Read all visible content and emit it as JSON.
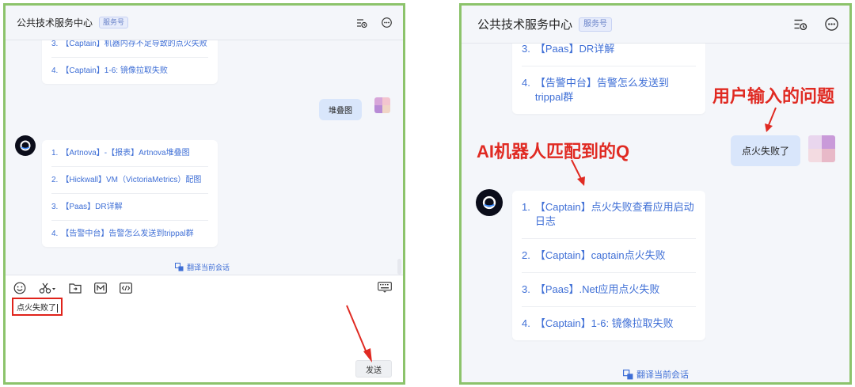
{
  "left": {
    "header": {
      "title": "公共技术服务中心",
      "badge": "服务号"
    },
    "top_card": {
      "items": [
        {
          "num": "3.",
          "text": "【Captain】机器内存不足导致的点火失败"
        },
        {
          "num": "4.",
          "text": "【Captain】1-6: 镜像拉取失败"
        }
      ]
    },
    "user_message": "堆叠图",
    "bot_card": {
      "items": [
        {
          "num": "1.",
          "text": "【Artnova】-【报表】Artnova堆叠图"
        },
        {
          "num": "2.",
          "text": "【Hickwall】VM（VictoriaMetrics）配图"
        },
        {
          "num": "3.",
          "text": "【Paas】DR详解"
        },
        {
          "num": "4.",
          "text": "【告警中台】告警怎么发送到trippal群"
        }
      ]
    },
    "translate": "翻译当前会话",
    "input_value": "点火失败了",
    "send_label": "发送",
    "toolbar_icons": [
      "emoji-icon",
      "scissors-icon",
      "folder-icon",
      "markdown-icon",
      "code-icon"
    ]
  },
  "right": {
    "header": {
      "title": "公共技术服务中心",
      "badge": "服务号"
    },
    "top_card": {
      "items": [
        {
          "num": "3.",
          "text": "【Paas】DR详解"
        },
        {
          "num": "4.",
          "text": "【告警中台】告警怎么发送到trippal群"
        }
      ]
    },
    "user_message": "点火失败了",
    "bot_card": {
      "items": [
        {
          "num": "1.",
          "text": "【Captain】点火失败查看应用启动日志"
        },
        {
          "num": "2.",
          "text": "【Captain】captain点火失败"
        },
        {
          "num": "3.",
          "text": "【Paas】.Net应用点火失败"
        },
        {
          "num": "4.",
          "text": "【Captain】1-6: 镜像拉取失败"
        }
      ]
    },
    "translate": "翻译当前会话"
  },
  "annotations": {
    "user_question": "用户输入的问题",
    "ai_match": "AI机器人匹配到的Q"
  },
  "colors": {
    "panel_border": "#8cc36b",
    "link": "#3f6fd6",
    "bubble": "#d9e6fb",
    "annotation": "#e02a22"
  }
}
